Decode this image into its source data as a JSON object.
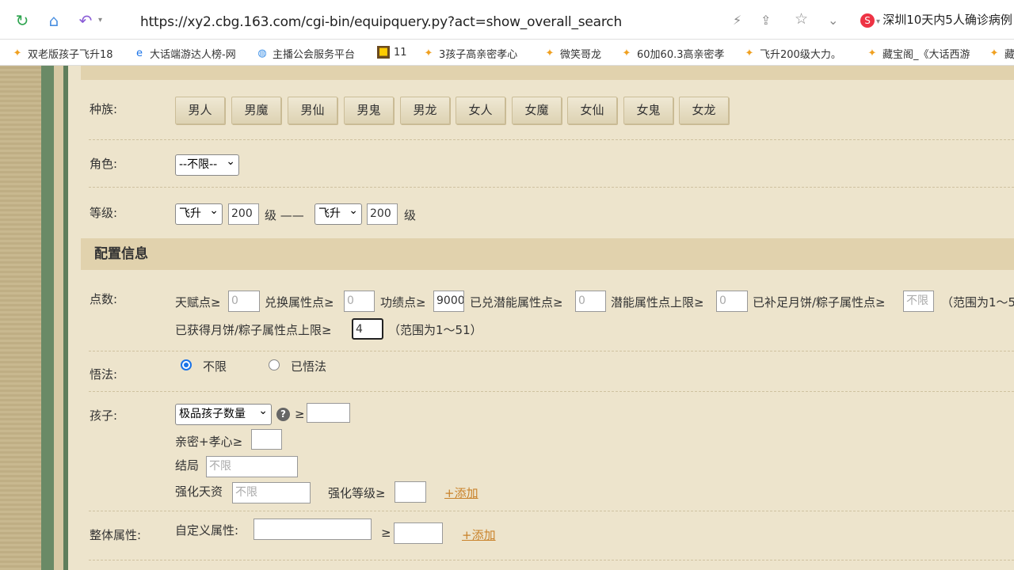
{
  "browser": {
    "url": "https://xy2.cbg.163.com/cgi-bin/equipquery.py?act=show_overall_search",
    "search_text": "深圳10天内5人确诊病例"
  },
  "bookmarks": [
    {
      "label": "双老版孩子飞升18",
      "icon": "star-icon"
    },
    {
      "label": "大话端游达人榜-网",
      "icon": "edge-icon"
    },
    {
      "label": "主播公会服务平台",
      "icon": "globe-icon"
    },
    {
      "label": "11",
      "icon": "game-icon"
    },
    {
      "label": "3孩子高亲密孝心",
      "icon": "star-icon"
    },
    {
      "label": "微笑哥龙",
      "icon": "star-icon"
    },
    {
      "label": "60加60.3高亲密孝",
      "icon": "star-icon"
    },
    {
      "label": "飞升200级大力。",
      "icon": "star-icon"
    },
    {
      "label": "藏宝阁_《大话西游",
      "icon": "star-icon"
    },
    {
      "label": "藏",
      "icon": "star-icon"
    }
  ],
  "form": {
    "race": {
      "label": "种族:",
      "options": [
        "男人",
        "男魔",
        "男仙",
        "男鬼",
        "男龙",
        "女人",
        "女魔",
        "女仙",
        "女鬼",
        "女龙"
      ]
    },
    "role": {
      "label": "角色:",
      "value": "--不限--"
    },
    "level": {
      "label": "等级:",
      "from_type": "飞升",
      "from_value": "200",
      "unit1": "级 ——",
      "to_type": "飞升",
      "to_value": "200",
      "unit2": "级"
    },
    "config_title": "配置信息",
    "points": {
      "label": "点数:",
      "talent": "天赋点≥",
      "talent_val": "0",
      "exchange": "兑换属性点≥",
      "exchange_val": "0",
      "merit": "功绩点≥",
      "merit_val": "9000",
      "potential": "已兑潜能属性点≥",
      "potential_val": "0",
      "potential_max": "潜能属性点上限≥",
      "potential_max_val": "0",
      "mooncake": "已补足月饼/粽子属性点≥",
      "mooncake_ph": "不限",
      "range1": "（范围为1～5",
      "mooncake_max": "已获得月饼/粽子属性点上限≥",
      "mooncake_max_val": "4",
      "range2": "（范围为1～51）"
    },
    "enlight": {
      "label": "悟法:",
      "opt1": "不限",
      "opt2": "已悟法"
    },
    "child": {
      "label": "孩子:",
      "select": "极品孩子数量",
      "ge": "≥",
      "intimacy": "亲密+孝心≥",
      "ending": "结局",
      "ending_ph": "不限",
      "talent": "强化天资",
      "talent_ph": "不限",
      "level": "强化等级≥",
      "add": "+添加"
    },
    "overall": {
      "label": "整体属性:",
      "custom": "自定义属性:",
      "ge": "≥",
      "add": "+添加"
    }
  }
}
